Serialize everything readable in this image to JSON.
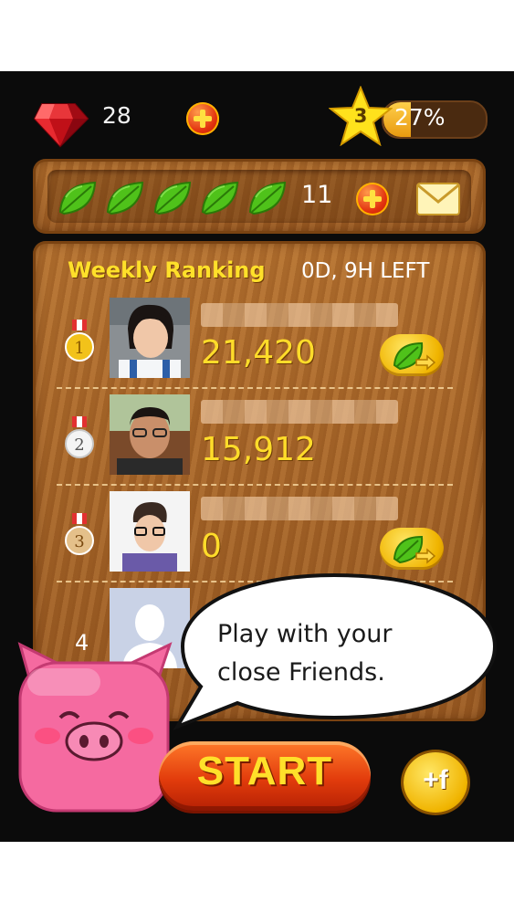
{
  "top_bar": {
    "gem_count": "28",
    "level": "3",
    "xp_percent_label": "27%",
    "xp_fraction": 0.27
  },
  "lives": {
    "leaves": 5,
    "count": "11"
  },
  "ranking": {
    "title": "Weekly Ranking",
    "time_left": "0D, 9H LEFT",
    "entries": [
      {
        "rank": "1",
        "score": "21,420",
        "has_send": true
      },
      {
        "rank": "2",
        "score": "15,912",
        "has_send": false
      },
      {
        "rank": "3",
        "score": "0",
        "has_send": true
      },
      {
        "rank": "4",
        "score": "",
        "has_send": false
      }
    ]
  },
  "bubble": {
    "text_line1": "Play with your",
    "text_line2": "close Friends."
  },
  "buttons": {
    "start": "START",
    "invite": "+f"
  },
  "colors": {
    "wood": "#a8652a",
    "accent_yellow": "#ffdc2a",
    "start_red": "#e23c0c",
    "leaf_green": "#4fc21a",
    "pig_pink": "#f56aa0"
  }
}
